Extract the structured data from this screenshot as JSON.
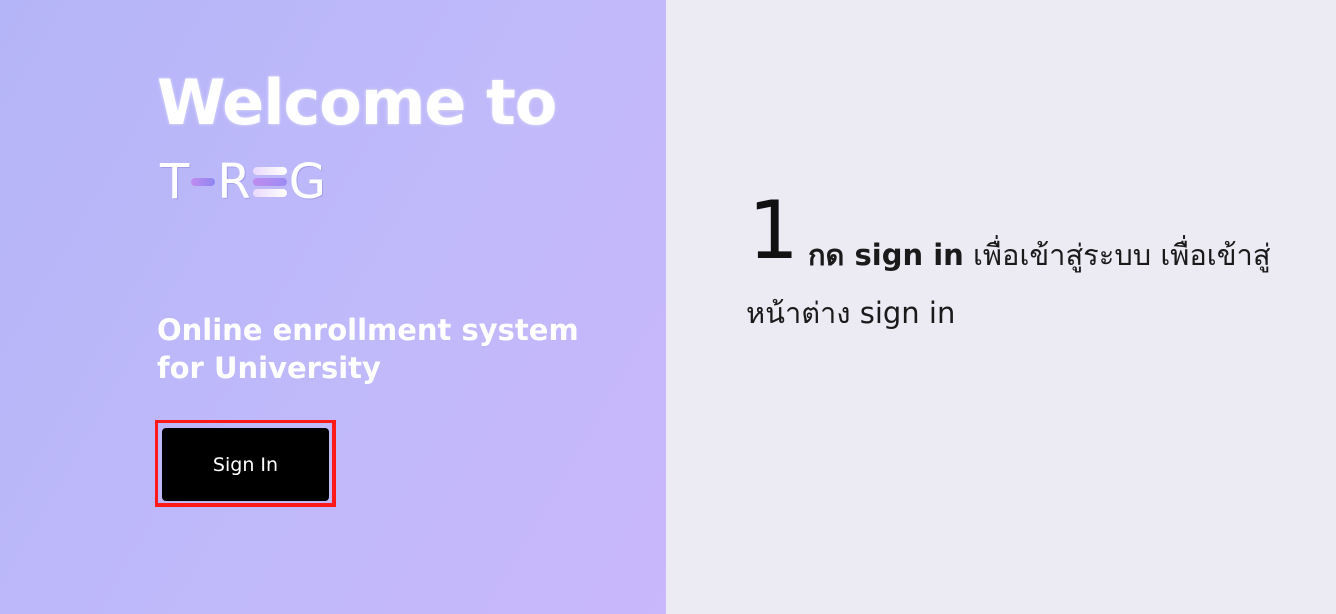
{
  "left": {
    "welcome_title": "Welcome to",
    "logo": {
      "letters": [
        "T",
        "R",
        "G"
      ],
      "aria": "T-REG"
    },
    "subtitle": "Online enrollment system for University",
    "signin_label": "Sign In"
  },
  "right": {
    "step_number": "1",
    "instruction_bold": "กด sign in",
    "instruction_rest": " เพื่อเข้าสู่ระบบ เพื่อเข้าสู่หน้าต่าง sign in"
  },
  "colors": {
    "left_gradient_start": "#b4b5f8",
    "left_gradient_end": "#c9b8fb",
    "right_background": "#ecebf4",
    "button_background": "#000000",
    "highlight_border": "#ff1a1a"
  }
}
